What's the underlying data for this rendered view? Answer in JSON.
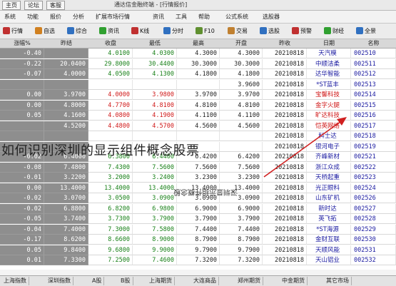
{
  "titlebar": {
    "tabs": [
      "主页",
      "论坛",
      "客服"
    ],
    "title": "通达信金融终端 - [行情报价]"
  },
  "menubar": {
    "items": [
      "系统",
      "功能",
      "报价",
      "分析",
      "扩展市场行情",
      "资讯",
      "工具",
      "帮助",
      "公式系统",
      "选股器"
    ]
  },
  "toolbar": {
    "items": [
      {
        "label": "行情",
        "icon": "quote-icon",
        "color": "#c03030"
      },
      {
        "label": "自选",
        "icon": "star-icon",
        "color": "#d08020"
      },
      {
        "label": "综合",
        "icon": "grid-icon",
        "color": "#3070c0"
      },
      {
        "label": "资讯",
        "icon": "news-icon",
        "color": "#30a030"
      },
      {
        "label": "K线",
        "icon": "kline-icon",
        "color": "#c03030"
      },
      {
        "label": "分时",
        "icon": "timeline-icon",
        "color": "#3070c0"
      },
      {
        "label": "F10",
        "icon": "f10-icon",
        "color": "#609030"
      },
      {
        "label": "交易",
        "icon": "trade-icon",
        "color": "#c08030"
      },
      {
        "label": "选股",
        "icon": "filter-icon",
        "color": "#3070c0"
      },
      {
        "label": "预警",
        "icon": "bell-icon",
        "color": "#c03030"
      },
      {
        "label": "财经",
        "icon": "chart-icon",
        "color": "#30a030"
      },
      {
        "label": "全景",
        "icon": "map-icon",
        "color": "#3070c0"
      }
    ]
  },
  "table": {
    "headers": [
      "代码",
      "名称",
      "日期",
      "昨收",
      "开盘",
      "最高",
      "最低",
      "收盘",
      "昨结",
      "涨跌",
      "涨幅%"
    ],
    "rows": [
      {
        "code": "002510",
        "name": "天汽模",
        "date": "20210818",
        "c1": "4.3000",
        "c2": "4.3000",
        "c3": "4.0300",
        "c4": "4.0100",
        "c5": "",
        "c6": "-0.40",
        "hl": "0"
      },
      {
        "code": "002511",
        "name": "中顺洁柔",
        "date": "20210818",
        "c1": "30.3000",
        "c2": "30.3000",
        "c3": "30.4400",
        "c4": "29.8000",
        "c5": "20.0400",
        "c6": "-0.22",
        "hl": "0"
      },
      {
        "code": "002512",
        "name": "达华智能",
        "date": "20210818",
        "c1": "4.1800",
        "c2": "4.1800",
        "c3": "4.1300",
        "c4": "4.0500",
        "c5": "4.0000",
        "c6": "-0.07",
        "hl": "0"
      },
      {
        "code": "002513",
        "name": "*ST蓝丰",
        "date": "20210818",
        "c1": "3.9600",
        "c2": "",
        "c3": "",
        "c4": "",
        "c5": "",
        "c6": "",
        "hl": "0"
      },
      {
        "code": "002514",
        "name": "宝馨科技",
        "date": "20210818",
        "c1": "3.9700",
        "c2": "3.9700",
        "c3": "3.9800",
        "c4": "4.0000",
        "c5": "3.9700",
        "c6": "0.00",
        "hl": "1"
      },
      {
        "code": "002515",
        "name": "金字火腿",
        "date": "20210818",
        "c1": "4.8100",
        "c2": "4.8100",
        "c3": "4.8100",
        "c4": "4.7700",
        "c5": "4.8000",
        "c6": "0.00",
        "hl": "1"
      },
      {
        "code": "002516",
        "name": "旷达科技",
        "date": "20210818",
        "c1": "4.1100",
        "c2": "4.1100",
        "c3": "4.1900",
        "c4": "4.0800",
        "c5": "4.1600",
        "c6": "0.05",
        "hl": "1"
      },
      {
        "code": "002517",
        "name": "恺英网络",
        "date": "20210818",
        "c1": "4.5600",
        "c2": "4.5600",
        "c3": "4.5700",
        "c4": "4.4800",
        "c5": "4.5200",
        "c6": "",
        "hl": "1"
      },
      {
        "code": "002518",
        "name": "科士达",
        "date": "20210818",
        "c1": "",
        "c2": "",
        "c3": "",
        "c4": "",
        "c5": "",
        "c6": "",
        "hl": "0"
      },
      {
        "code": "002519",
        "name": "银河电子",
        "date": "20210818",
        "c1": "",
        "c2": "",
        "c3": "",
        "c4": "",
        "c5": "",
        "c6": "",
        "hl": "0"
      },
      {
        "code": "002521",
        "name": "齐峰新材",
        "date": "20210818",
        "c1": "6.4200",
        "c2": "6.4200",
        "c3": "6.4400",
        "c4": "6.3800",
        "c5": "6.4000",
        "c6": "-0.02",
        "hl": "0"
      },
      {
        "code": "002522",
        "name": "浙江众成",
        "date": "20210818",
        "c1": "7.5600",
        "c2": "7.5600",
        "c3": "7.5600",
        "c4": "7.4300",
        "c5": "7.4800",
        "c6": "-0.08",
        "hl": "0"
      },
      {
        "code": "002523",
        "name": "天桥起重",
        "date": "20210818",
        "c1": "3.2300",
        "c2": "3.2300",
        "c3": "3.2400",
        "c4": "3.2000",
        "c5": "3.2200",
        "c6": "-0.01",
        "hl": "0"
      },
      {
        "code": "002524",
        "name": "光正眼科",
        "date": "20210818",
        "c1": "13.4000",
        "c2": "13.4000",
        "c3": "13.4000",
        "c4": "13.4000",
        "c5": "13.4000",
        "c6": "0.00",
        "hl": "0"
      },
      {
        "code": "002526",
        "name": "山东矿机",
        "date": "20210818",
        "c1": "3.0900",
        "c2": "3.0900",
        "c3": "3.0900",
        "c4": "3.0500",
        "c5": "3.0700",
        "c6": "-0.02",
        "hl": "0"
      },
      {
        "code": "002527",
        "name": "新时达",
        "date": "20210818",
        "c1": "6.9000",
        "c2": "6.9000",
        "c3": "6.9800",
        "c4": "6.8200",
        "c5": "6.8800",
        "c6": "-0.02",
        "hl": "0"
      },
      {
        "code": "002528",
        "name": "英飞拓",
        "date": "20210818",
        "c1": "3.7900",
        "c2": "3.7900",
        "c3": "3.7900",
        "c4": "3.7300",
        "c5": "3.7400",
        "c6": "-0.05",
        "hl": "0"
      },
      {
        "code": "002529",
        "name": "*ST海源",
        "date": "20210818",
        "c1": "7.4400",
        "c2": "7.4400",
        "c3": "7.5800",
        "c4": "7.3000",
        "c5": "7.4000",
        "c6": "-0.04",
        "hl": "0"
      },
      {
        "code": "002530",
        "name": "金财互联",
        "date": "20210818",
        "c1": "8.7900",
        "c2": "8.7900",
        "c3": "8.9000",
        "c4": "8.6600",
        "c5": "8.6200",
        "c6": "-0.17",
        "hl": "0"
      },
      {
        "code": "002531",
        "name": "天顺风能",
        "date": "20210818",
        "c1": "9.7900",
        "c2": "9.7900",
        "c3": "9.9000",
        "c4": "9.6800",
        "c5": "9.8400",
        "c6": "0.05",
        "hl": "0"
      },
      {
        "code": "002532",
        "name": "天山铝业",
        "date": "20210818",
        "c1": "7.3200",
        "c2": "7.3200",
        "c3": "7.4600",
        "c4": "7.2500",
        "c5": "7.3300",
        "c6": "0.01",
        "hl": "0"
      }
    ]
  },
  "statusbar": {
    "items": [
      "上海指数",
      "深圳指数",
      "A股",
      "B股",
      "上海期货",
      "大连商品",
      "郑州期货",
      "中金期货",
      "其它市场"
    ]
  },
  "overlay_text": "如何识别深圳的显示组件概念股票",
  "watermark": "深圳显示组件概念股"
}
